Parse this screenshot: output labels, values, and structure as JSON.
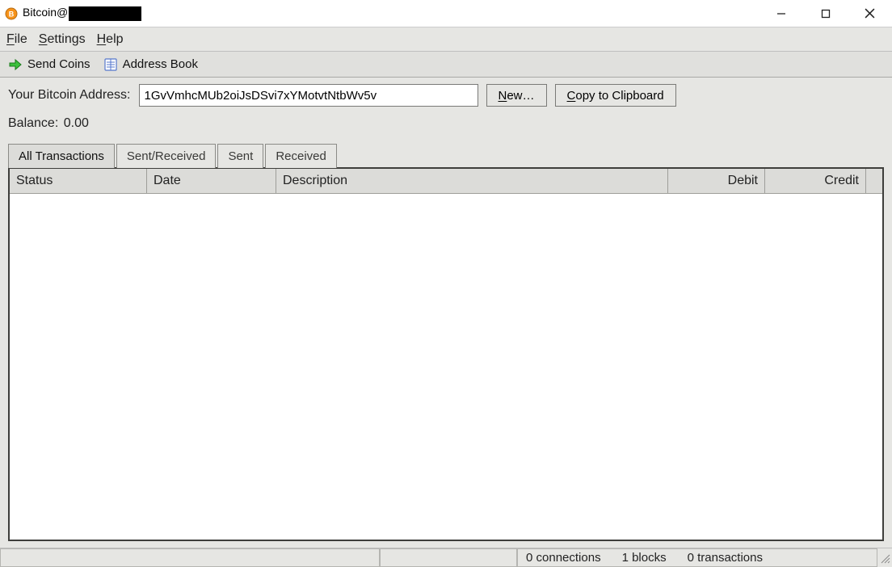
{
  "window": {
    "title_prefix": "Bitcoin@"
  },
  "menu": {
    "file": "File",
    "settings": "Settings",
    "help": "Help"
  },
  "toolbar": {
    "send_coins": "Send Coins",
    "address_book": "Address Book"
  },
  "address": {
    "label": "Your Bitcoin Address:",
    "value": "1GvVmhcMUb2oiJsDSvi7xYMotvtNtbWv5v",
    "new_btn": "New…",
    "copy_btn": "Copy to Clipboard"
  },
  "balance": {
    "label": "Balance:",
    "value": "0.00"
  },
  "tabs": {
    "all": "All Transactions",
    "sent_received": "Sent/Received",
    "sent": "Sent",
    "received": "Received"
  },
  "table": {
    "columns": {
      "status": "Status",
      "date": "Date",
      "description": "Description",
      "debit": "Debit",
      "credit": "Credit"
    },
    "rows": []
  },
  "status": {
    "connections": "0 connections",
    "blocks": "1 blocks",
    "transactions": "0 transactions"
  }
}
